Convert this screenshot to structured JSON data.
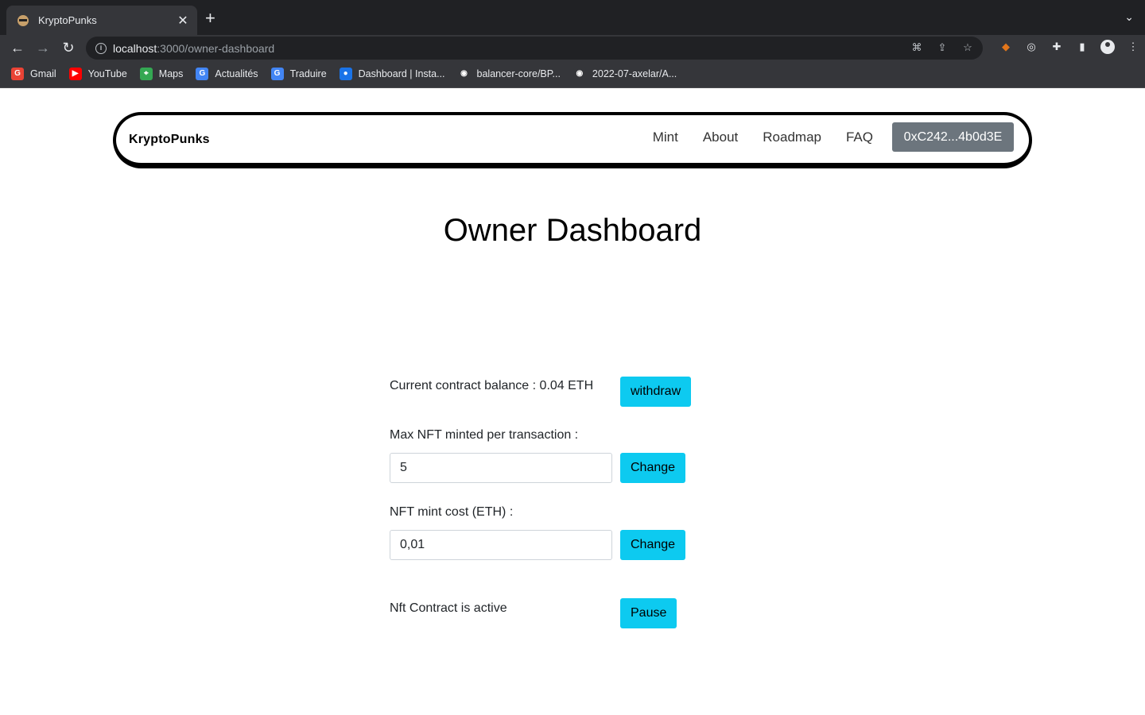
{
  "browser": {
    "tab_title": "KryptoPunks",
    "tab_close": "✕",
    "new_tab": "+",
    "url_host": "localhost",
    "url_rest": ":3000/owner-dashboard",
    "bookmarks": [
      {
        "label": "Gmail",
        "icon": "gmail-icon",
        "color": "#ea4335",
        "glyph": "G"
      },
      {
        "label": "YouTube",
        "icon": "youtube-icon",
        "color": "#ff0000",
        "glyph": "▶"
      },
      {
        "label": "Maps",
        "icon": "maps-icon",
        "color": "#34a853",
        "glyph": "⌖"
      },
      {
        "label": "Actualités",
        "icon": "news-icon",
        "color": "#4285f4",
        "glyph": "G"
      },
      {
        "label": "Traduire",
        "icon": "translate-icon",
        "color": "#4285f4",
        "glyph": "G"
      },
      {
        "label": "Dashboard | Insta...",
        "icon": "dashboard-icon",
        "color": "#1a73e8",
        "glyph": "●"
      },
      {
        "label": "balancer-core/BP...",
        "icon": "github-icon",
        "color": "#35363a",
        "glyph": "◉"
      },
      {
        "label": "2022-07-axelar/A...",
        "icon": "github-icon",
        "color": "#35363a",
        "glyph": "◉"
      }
    ]
  },
  "navbar": {
    "brand": "KryptoPunks",
    "links": [
      "Mint",
      "About",
      "Roadmap",
      "FAQ"
    ],
    "wallet": "0xC242...4b0d3E"
  },
  "dashboard": {
    "title": "Owner Dashboard",
    "balance_text": "Current contract balance : 0.04 ETH",
    "withdraw_label": "withdraw",
    "max_label": "Max NFT minted per transaction :",
    "max_value": "5",
    "cost_label": "NFT mint cost (ETH) :",
    "cost_value": "0,01",
    "change_label": "Change",
    "status_text": "Nft Contract is active",
    "pause_label": "Pause"
  }
}
